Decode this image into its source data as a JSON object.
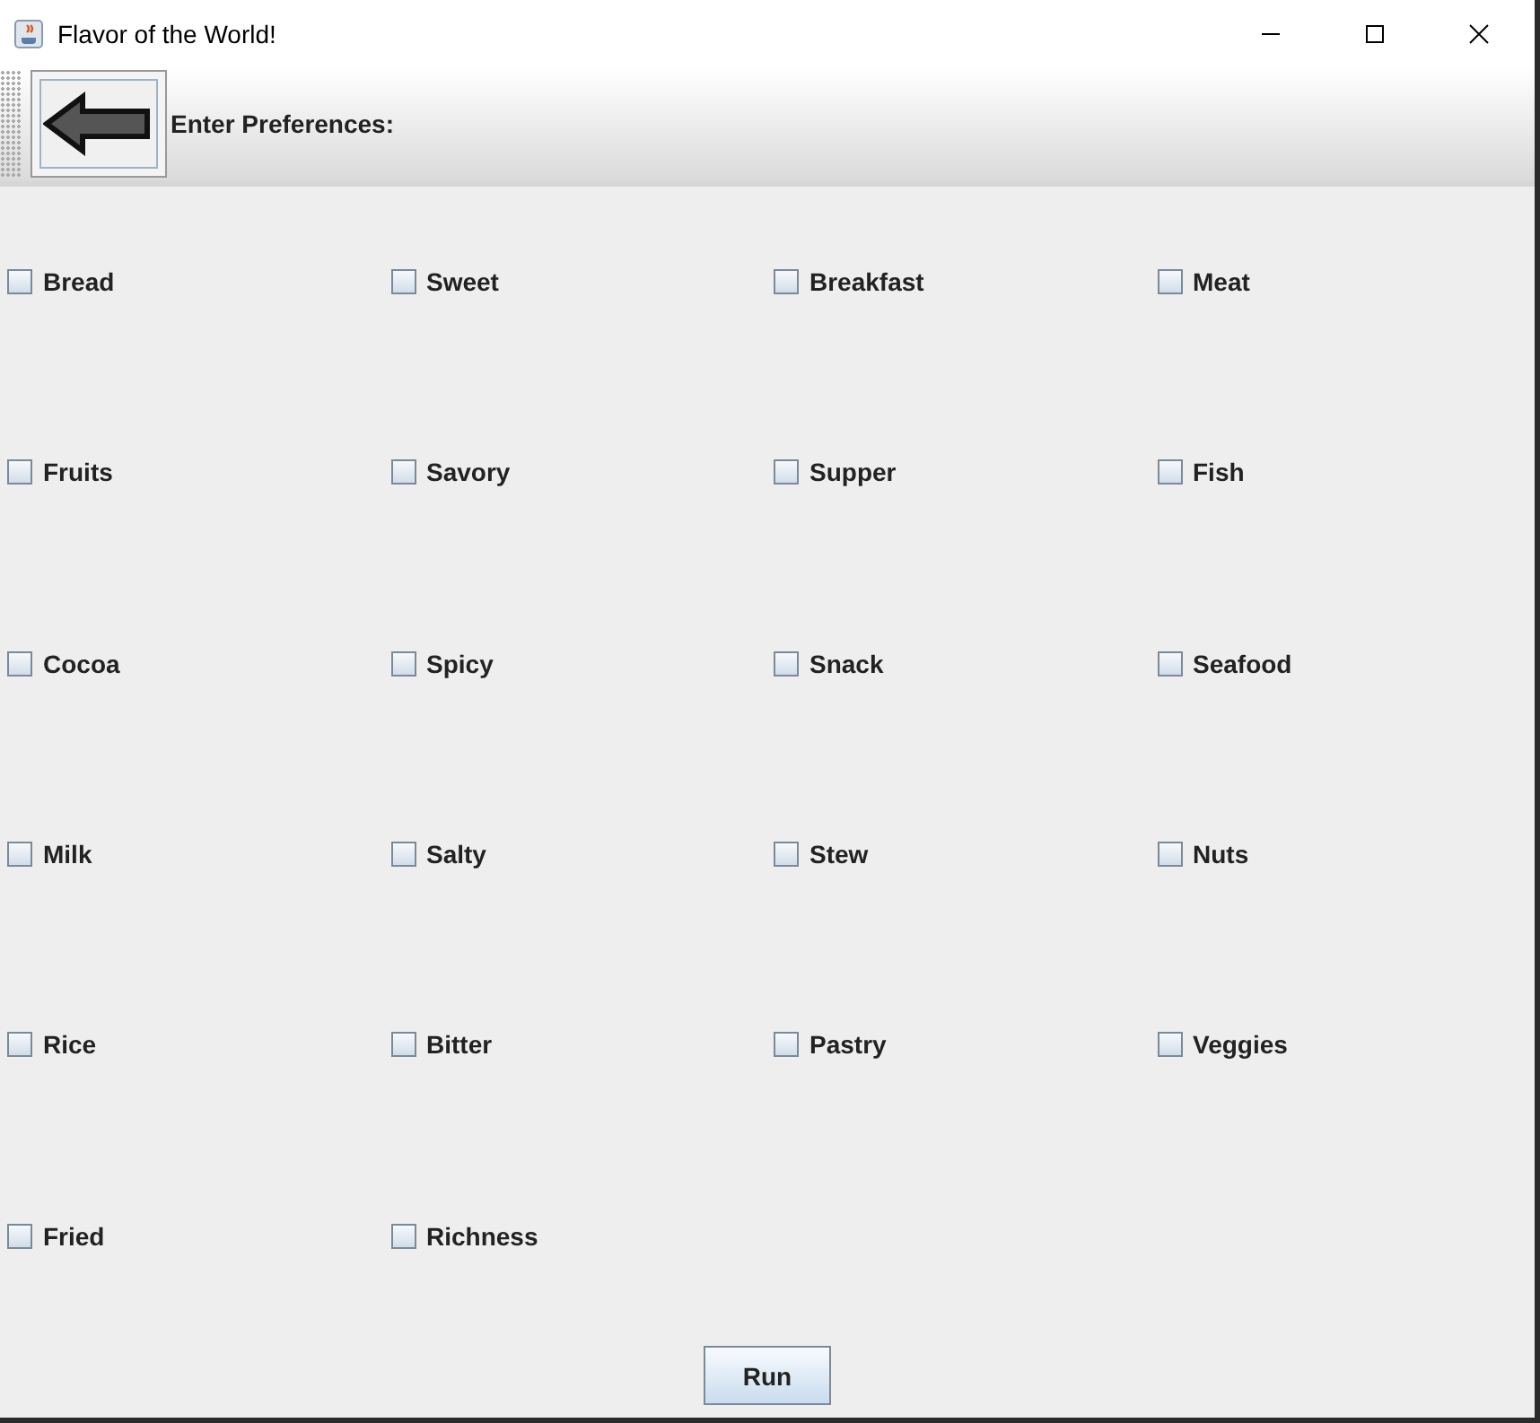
{
  "window": {
    "title": "Flavor of the World!"
  },
  "toolbar": {
    "label": "Enter Preferences:"
  },
  "preferences": [
    {
      "label": "Bread",
      "checked": false
    },
    {
      "label": "Sweet",
      "checked": false
    },
    {
      "label": "Breakfast",
      "checked": false
    },
    {
      "label": "Meat",
      "checked": false
    },
    {
      "label": "Fruits",
      "checked": false
    },
    {
      "label": "Savory",
      "checked": false
    },
    {
      "label": "Supper",
      "checked": false
    },
    {
      "label": "Fish",
      "checked": false
    },
    {
      "label": "Cocoa",
      "checked": false
    },
    {
      "label": "Spicy",
      "checked": false
    },
    {
      "label": "Snack",
      "checked": false
    },
    {
      "label": "Seafood",
      "checked": false
    },
    {
      "label": "Milk",
      "checked": false
    },
    {
      "label": "Salty",
      "checked": false
    },
    {
      "label": "Stew",
      "checked": false
    },
    {
      "label": "Nuts",
      "checked": false
    },
    {
      "label": "Rice",
      "checked": false
    },
    {
      "label": "Bitter",
      "checked": false
    },
    {
      "label": "Pastry",
      "checked": false
    },
    {
      "label": "Veggies",
      "checked": false
    },
    {
      "label": "Fried",
      "checked": false
    },
    {
      "label": "Richness",
      "checked": false
    }
  ],
  "buttons": [
    "Run"
  ]
}
